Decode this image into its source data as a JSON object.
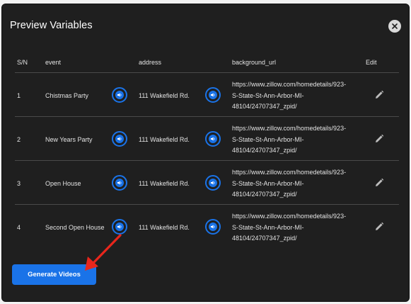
{
  "modal": {
    "title": "Preview Variables",
    "close_icon": "close-icon"
  },
  "table": {
    "headers": {
      "sn": "S/N",
      "event": "event",
      "address": "address",
      "background_url": "background_url",
      "edit": "Edit"
    },
    "rows": [
      {
        "sn": "1",
        "event": "Chistmas Party",
        "address": "111 Wakefield Rd.",
        "url_line1": "https://www.zillow.com/homedetails/923-",
        "url_line2": "S-State-St-Ann-Arbor-MI-",
        "url_line3": "48104/24707347_zpid/"
      },
      {
        "sn": "2",
        "event": "New Years Party",
        "address": "111 Wakefield Rd.",
        "url_line1": "https://www.zillow.com/homedetails/923-",
        "url_line2": "S-State-St-Ann-Arbor-MI-",
        "url_line3": "48104/24707347_zpid/"
      },
      {
        "sn": "3",
        "event": "Open House",
        "address": "111 Wakefield Rd.",
        "url_line1": "https://www.zillow.com/homedetails/923-",
        "url_line2": "S-State-St-Ann-Arbor-MI-",
        "url_line3": "48104/24707347_zpid/"
      },
      {
        "sn": "4",
        "event": "Second Open House",
        "address": "111 Wakefield Rd.",
        "url_line1": "https://www.zillow.com/homedetails/923-",
        "url_line2": "S-State-St-Ann-Arbor-MI-",
        "url_line3": "48104/24707347_zpid/"
      }
    ],
    "icons": {
      "audio": "speaker-icon",
      "edit": "pencil-icon"
    }
  },
  "actions": {
    "generate_label": "Generate Videos"
  },
  "annotation": {
    "arrow": "red-arrow",
    "color": "#e8261c"
  },
  "colors": {
    "modal_bg": "#1f1f1f",
    "accent": "#1a73e8",
    "text": "#e3e3e3"
  }
}
